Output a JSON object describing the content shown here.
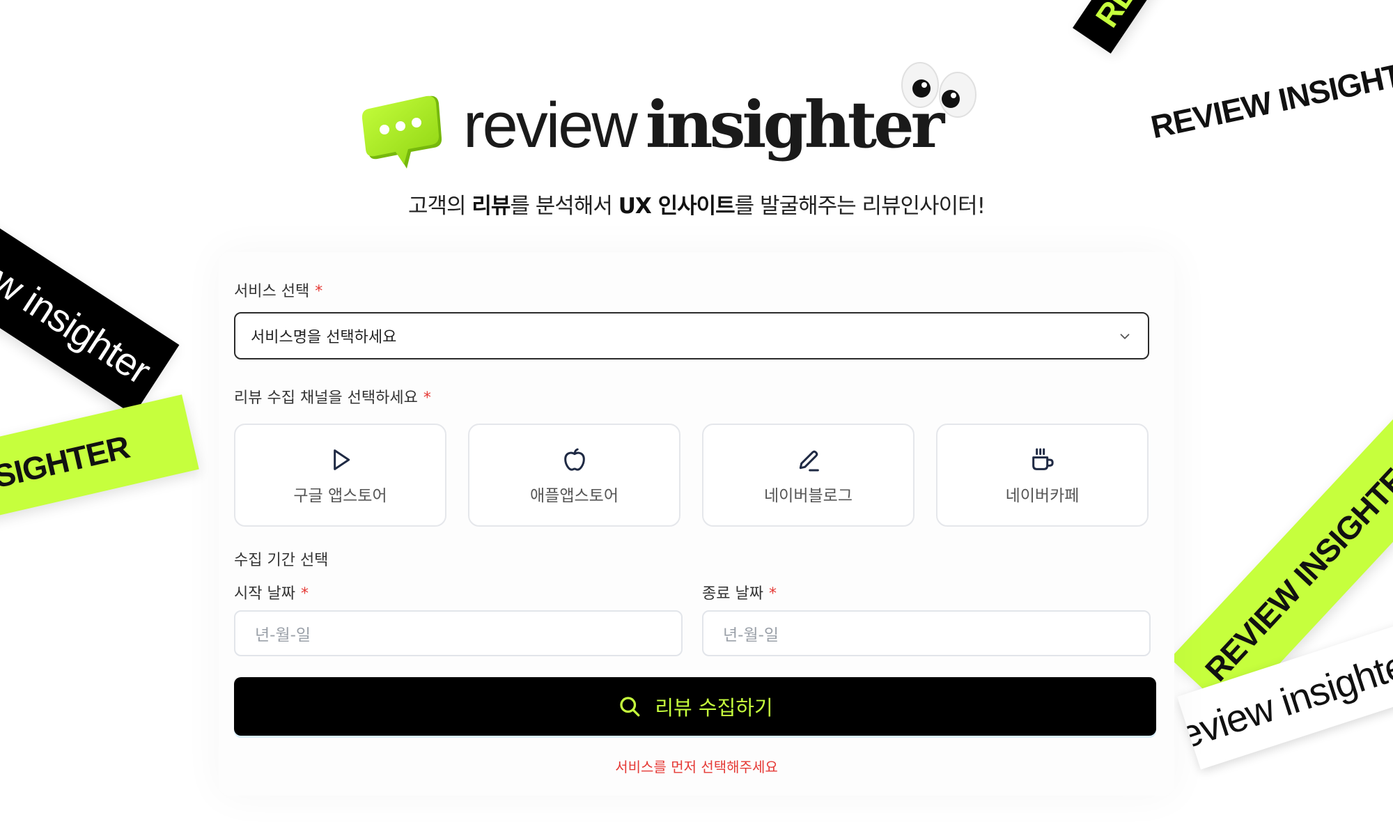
{
  "brand": {
    "logo_light": "review",
    "logo_bold": "insighter",
    "accent_color": "#c6ff3d"
  },
  "tagline": {
    "part1": "고객의 ",
    "bold1": "리뷰",
    "part2": "를 분석해서 ",
    "bold2": "UX 인사이트",
    "part3": "를 발굴해주는 리뷰인사이터!"
  },
  "ribbons": {
    "lowercase": "review insighter",
    "uppercase": "REVIEW INSIGHTER"
  },
  "form": {
    "service": {
      "label": "서비스 선택",
      "required_mark": "*",
      "placeholder": "서비스명을 선택하세요"
    },
    "channels": {
      "label": "리뷰 수집 채널을 선택하세요",
      "required_mark": "*",
      "items": [
        {
          "label": "구글 앱스토어",
          "icon": "play-icon"
        },
        {
          "label": "애플앱스토어",
          "icon": "apple-icon"
        },
        {
          "label": "네이버블로그",
          "icon": "pencil-icon"
        },
        {
          "label": "네이버카페",
          "icon": "coffee-cup-icon"
        }
      ]
    },
    "period": {
      "label": "수집 기간 선택",
      "start_label": "시작 날짜",
      "end_label": "종료 날짜",
      "required_mark": "*",
      "start_placeholder": "년-월-일",
      "end_placeholder": "년-월-일"
    },
    "submit_label": "리뷰 수집하기",
    "error_message": "서비스를 먼저 선택해주세요"
  }
}
